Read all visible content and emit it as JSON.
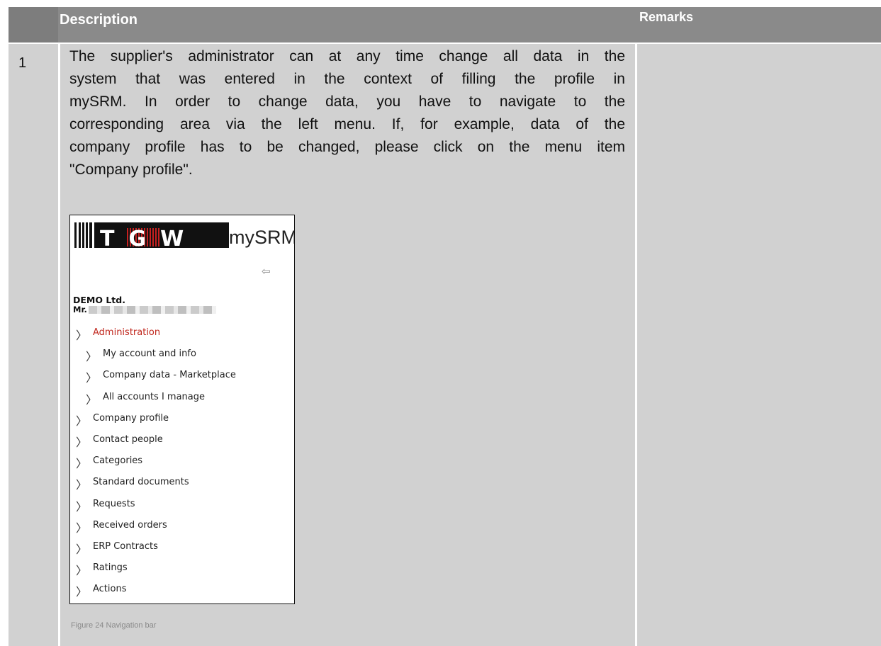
{
  "table": {
    "header": {
      "description": "Description",
      "remarks": "Remarks"
    },
    "row": {
      "number": "1",
      "text_lines": [
        "The supplier's administrator can at any time change all data in the",
        "system that was entered in the context of filling the profile in",
        "mySRM. In order to change data, you have to navigate to the",
        "corresponding area via the left menu. If, for example, data of the",
        "company profile has to be changed, please click on the menu item",
        "\"Company profile\"."
      ],
      "remarks": ""
    }
  },
  "figure": {
    "logo_text": "TGW",
    "app_name": "mySRM",
    "back_icon": "arrow-left-icon",
    "company": "DEMO Ltd.",
    "person_prefix": "Mr.",
    "menu": [
      {
        "label": "Administration",
        "level": 0,
        "active": true
      },
      {
        "label": "My account and info",
        "level": 1
      },
      {
        "label": "Company data - Marketplace",
        "level": 1
      },
      {
        "label": "All accounts I manage",
        "level": 1
      },
      {
        "label": "Company profile",
        "level": 0
      },
      {
        "label": "Contact people",
        "level": 0
      },
      {
        "label": "Categories",
        "level": 0
      },
      {
        "label": "Standard documents",
        "level": 0
      },
      {
        "label": "Requests",
        "level": 0
      },
      {
        "label": "Received orders",
        "level": 0
      },
      {
        "label": "ERP Contracts",
        "level": 0
      },
      {
        "label": "Ratings",
        "level": 0
      },
      {
        "label": "Actions",
        "level": 0
      }
    ],
    "caption": "Figure 24 Navigation bar"
  },
  "colors": {
    "header_bg": "#8a8a8a",
    "cell_bg": "#d1d1d1",
    "active_menu": "#c0261c"
  }
}
